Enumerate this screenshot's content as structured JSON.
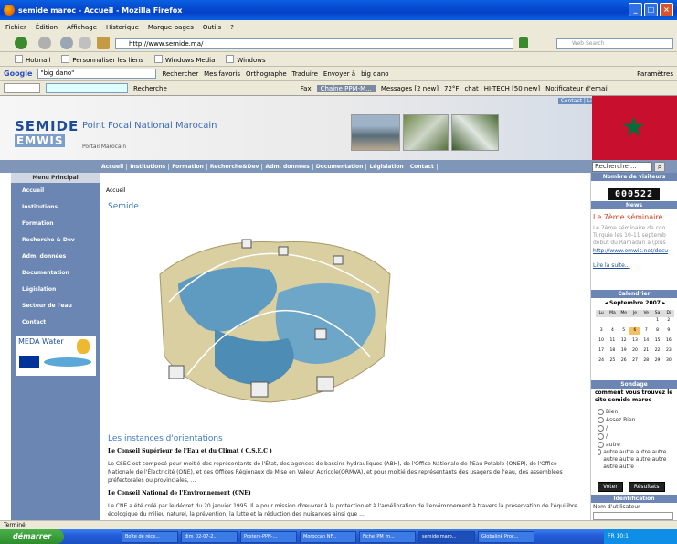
{
  "window": {
    "title": "semide maroc - Accueil - Mozilla Firefox"
  },
  "menubar": [
    "Fichier",
    "Édition",
    "Affichage",
    "Historique",
    "Marque-pages",
    "Outils",
    "?"
  ],
  "navbar": {
    "url": "http://www.semide.ma/",
    "search_placeholder": "Web Search"
  },
  "bookmarks": [
    "Hotmail",
    "Personnaliser les liens",
    "Windows Media",
    "Windows"
  ],
  "google_toolbar": {
    "logo": "Google",
    "query": "\"big dano\"",
    "items": [
      "Rechercher",
      "Mes favoris",
      "Orthographe",
      "Traduire",
      "Envoyer à",
      "big dano",
      "Paramètres"
    ]
  },
  "toolbar2": {
    "search": "Recherche",
    "items": [
      "Fax",
      "Chaîne PPM-M...",
      "Messages [2 new]",
      "72°F",
      "chat",
      "HI-TECH [50 new]",
      "Notificateur d'email"
    ]
  },
  "site": {
    "top_links": "Contact | Liens | Flux RSS | Plan du Site",
    "logo_line1": "SEMIDE",
    "logo_line2": "EMWIS",
    "title": "Point Focal National Marocain",
    "subtitle": "Portail Marocain",
    "topnav": [
      "Accueil",
      "Institutions",
      "Formation",
      "Recherche&Dev",
      "Adm. données",
      "Documentation",
      "Législation",
      "Contact"
    ],
    "search_value": "Rechercher...",
    "menu_title": "Menu Principal",
    "menu": [
      "Accueil",
      "Institutions",
      "Formation",
      "Recherche & Dev",
      "Adm. données",
      "Documentation",
      "Législation",
      "Secteur de l'eau",
      "Contact"
    ],
    "partner_logo": "MEDA Water",
    "breadcrumb": "Accueil",
    "heading": "Semide",
    "section_title": "Les instances d'orientations",
    "sub1": "Le Conseil Supérieur de l'Eau et du Climat ( C.S.E.C )",
    "para1": "Le CSEC est composé pour moitié des représentants de l'État, des agences de bassins hydrauliques (ABH), de l'Office Nationale de l'Eau Potable (ONEP), de l'Office Nationale de l'Électricité (ONE), et des Offices Régionaux de Mise en Valeur Agricole(ORMVA), et pour moitié des représentants des usagers de l'eau, des assemblées préfectorales ou provinciales, ...",
    "sub2": "Le Conseil National de l'Environnement (CNE)",
    "para2": "Le CNE a été créé par le décret du 20 janvier 1995. Il a pour mission d'œuvrer à la protection et à l'amélioration de l'environnement à travers la préservation de l'équilibre écologique du milieu naturel, la prévention, la lutte et la réduction des nuisances ainsi que ...",
    "visitors_title": "Nombre de visiteurs",
    "visitors": "000522",
    "news_title": "News",
    "news_headline": "Le 7ème séminaire",
    "news_body": "Le 7ème séminaire de coo Turquie les 10-11 septemb début du Ramadan a (plus",
    "news_link": "http://www.emwis.net/docu",
    "news_more": "Lire la suite...",
    "calendar_title": "Calendrier",
    "calendar_month": "Septembre 2007",
    "calendar_days": [
      "Lu",
      "Ma",
      "Me",
      "Je",
      "Ve",
      "Sa",
      "Di"
    ],
    "calendar_dates": [
      "",
      "",
      "",
      "",
      "",
      "1",
      "2",
      "3",
      "4",
      "5",
      "6",
      "7",
      "8",
      "9",
      "10",
      "11",
      "12",
      "13",
      "14",
      "15",
      "16",
      "17",
      "18",
      "19",
      "20",
      "21",
      "22",
      "23",
      "24",
      "25",
      "26",
      "27",
      "28",
      "29",
      "30"
    ],
    "poll_title": "Sondage",
    "poll_question": "comment vous trouvez le site semide maroc",
    "poll_options": [
      "Bien",
      "Assez Bien",
      "/",
      "/",
      "autre",
      "autre autre autre autre autre autre autre autre autre autre"
    ],
    "vote_label": "Voter",
    "results_label": "Résultats",
    "login_title": "Identification",
    "login_label": "Nom d'utilisateur"
  },
  "status": "Terminé",
  "taskbar": {
    "start": "démarrer",
    "tasks": [
      "Boîte de réce...",
      "dim_02-07-2...",
      "Posters-PPN-...",
      "Moroccan NF...",
      "Fiche_PM_m...",
      "semide maro...",
      "Globalink Proc..."
    ],
    "tray": "FR  10:1"
  }
}
